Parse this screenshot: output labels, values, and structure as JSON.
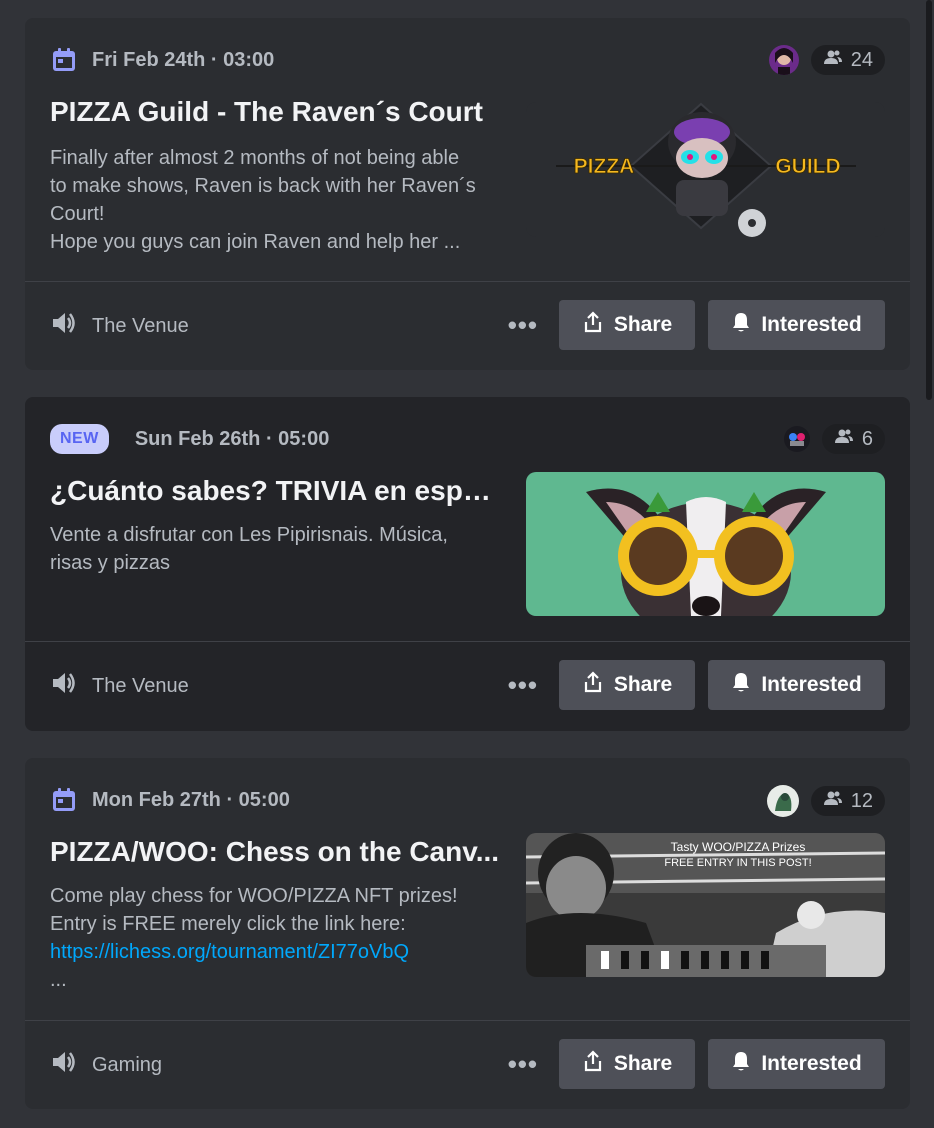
{
  "colors": {
    "background": "#313338",
    "card": "#2b2d31",
    "accent": "#5865f2",
    "link": "#00a8fc"
  },
  "events": [
    {
      "date": "Fri Feb 24th · 03:00",
      "badge": "",
      "attendee_count": "24",
      "title": "PIZZA Guild - The Raven´s Court",
      "description_lines": [
        "Finally after almost 2 months of not being able",
        "to make shows, Raven is back with her Raven´s",
        "Court!",
        "Hope you guys can join Raven and help her ..."
      ],
      "channel": "The Venue",
      "thumb_left": "PIZZA",
      "thumb_right": "GUILD",
      "share_label": "Share",
      "interested_label": "Interested"
    },
    {
      "date": "Sun Feb 26th · 05:00",
      "badge": "NEW",
      "attendee_count": "6",
      "title": "¿Cuánto sabes? TRIVIA en espa...",
      "description_lines": [
        "Vente a disfrutar con Les Pipirisnais. Música,",
        "risas y pizzas"
      ],
      "channel": "The Venue",
      "share_label": "Share",
      "interested_label": "Interested"
    },
    {
      "date": "Mon Feb 27th · 05:00",
      "badge": "",
      "attendee_count": "12",
      "title": "PIZZA/WOO: Chess on the Canv...",
      "description_lines": [
        "Come play chess for WOO/PIZZA NFT prizes!",
        "Entry is FREE merely click the link here:"
      ],
      "link": "https://lichess.org/tournament/ZI77oVbQ",
      "ellipsis": "...",
      "channel": "Gaming",
      "thumb_text_1": "Tasty WOO/PIZZA Prizes",
      "thumb_text_2": "FREE ENTRY IN THIS POST!",
      "share_label": "Share",
      "interested_label": "Interested"
    }
  ]
}
